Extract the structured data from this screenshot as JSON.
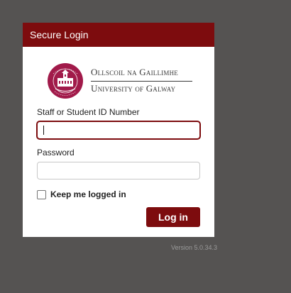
{
  "header": {
    "title": "Secure Login"
  },
  "logo": {
    "seal_icon": "university-crest-seal",
    "line1": "Ollscoil na Gaillimhe",
    "line2": "University of Galway"
  },
  "form": {
    "id_label": "Staff or Student ID Number",
    "id_value": "",
    "id_placeholder": "",
    "password_label": "Password",
    "password_value": "",
    "password_placeholder": "",
    "remember_label": "Keep me logged in",
    "remember_checked": false,
    "login_button": "Log in"
  },
  "footer": {
    "version": "Version 5.0.34.3"
  },
  "colors": {
    "background": "#555352",
    "brand": "#7d0c0e",
    "panel": "#ffffff"
  }
}
